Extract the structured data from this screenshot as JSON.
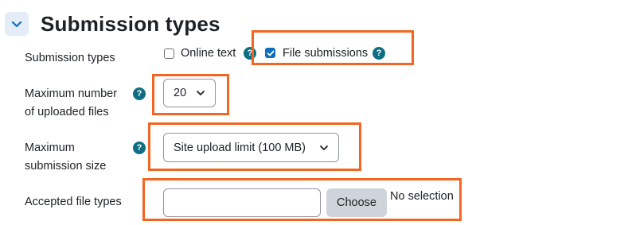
{
  "section": {
    "title": "Submission types",
    "toggle_icon": "chevron-down-icon"
  },
  "submission_types": {
    "label": "Submission types",
    "options": [
      {
        "label": "Online text",
        "checked": false
      },
      {
        "label": "File submissions",
        "checked": true
      }
    ]
  },
  "max_files": {
    "label_line1": "Maximum number",
    "label_line2": "of uploaded files",
    "selected": "20"
  },
  "max_size": {
    "label_line1": "Maximum",
    "label_line2": "submission size",
    "selected": "Site upload limit (100 MB)"
  },
  "file_types": {
    "label": "Accepted file types",
    "input_value": "",
    "choose_label": "Choose",
    "status": "No selection"
  },
  "help_icon_glyph": "?",
  "colors": {
    "accent": "#0f6cbf",
    "help": "#0f6e83",
    "highlight": "#f26522"
  }
}
